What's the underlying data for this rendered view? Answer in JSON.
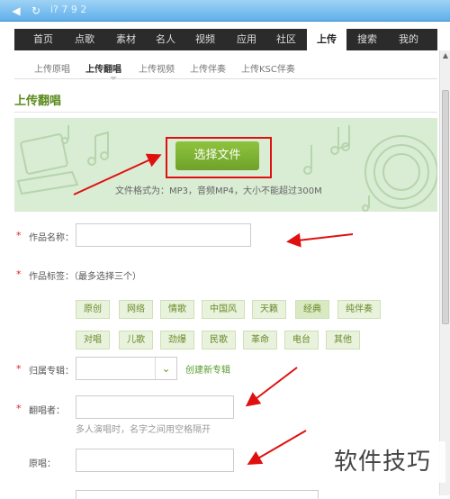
{
  "browser": {
    "back_icon": "back-arrow-icon",
    "refresh_icon": "refresh-icon",
    "title_fragment": "i? 7 9 2"
  },
  "topnav": {
    "items": [
      "首页",
      "点歌",
      "素材",
      "名人",
      "视频",
      "应用",
      "社区",
      "上传",
      "搜索",
      "我的"
    ],
    "active": "上传"
  },
  "subnav": {
    "items": [
      "上传原唱",
      "上传翻唱",
      "上传视频",
      "上传伴奏",
      "上传KSC伴奏"
    ],
    "active": "上传翻唱"
  },
  "page": {
    "title": "上传翻唱"
  },
  "upload": {
    "button_label": "选择文件",
    "format_note": "文件格式为：MP3，音频MP4，大小不能超过300M"
  },
  "form": {
    "required_mark": "*",
    "name_label": "作品名称：",
    "name_value": "",
    "tags_label": "作品标签：（最多选择三个）",
    "tags_row1": [
      "原创",
      "网络",
      "情歌",
      "中国风",
      "天籁",
      "经典",
      "纯伴奏"
    ],
    "tags_row2": [
      "对唱",
      "儿歌",
      "劲爆",
      "民歌",
      "革命",
      "电台",
      "其他"
    ],
    "album_label": "归属专辑：",
    "album_value": "",
    "create_album_link": "创建新专辑",
    "singer_label": "翻唱者：",
    "singer_value": "",
    "singer_hint": "多人演唱时，名字之间用空格隔开",
    "original_label": "原唱：",
    "original_value": ""
  },
  "watermark": "软件技巧",
  "colors": {
    "accent_green": "#6ea22a",
    "annotation_red": "#e01010",
    "nav_dark": "#2b2b2b"
  }
}
